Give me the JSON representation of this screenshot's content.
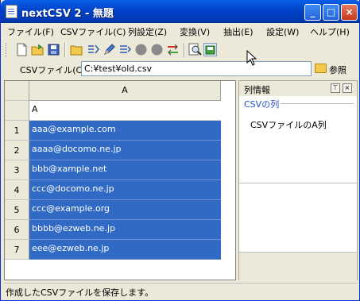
{
  "window": {
    "title": "nextCSV 2 - 無題"
  },
  "menu": [
    {
      "label": "ファイル(F)"
    },
    {
      "label": "CSVファイル(C)"
    },
    {
      "label": "列設定(Z)"
    },
    {
      "label": "変換(V)"
    },
    {
      "label": "抽出(E)"
    },
    {
      "label": "設定(W)"
    },
    {
      "label": "ヘルプ(H)"
    }
  ],
  "toolbar_icons": [
    "new-file-icon",
    "open-folder-icon",
    "save-icon",
    "folder-icon",
    "split-columns-icon",
    "pencil-icon",
    "merge-columns-icon",
    "gray-circle-icon",
    "gray-circle-icon",
    "convert-icon",
    "search-icon",
    "save-csv-icon"
  ],
  "pathbar": {
    "label": "CSVファイル(C)",
    "value": "C:¥test¥old.csv",
    "browse_label": "参照"
  },
  "grid": {
    "column_header": "A",
    "header_row_value": "A",
    "rows": [
      {
        "num": "1",
        "value": "aaa@example.com"
      },
      {
        "num": "2",
        "value": "aaaa@docomo.ne.jp"
      },
      {
        "num": "3",
        "value": "bbb@xample.net"
      },
      {
        "num": "4",
        "value": "ccc@docomo.ne.jp"
      },
      {
        "num": "5",
        "value": "ccc@example.org"
      },
      {
        "num": "6",
        "value": "bbbb@ezweb.ne.jp"
      },
      {
        "num": "7",
        "value": "eee@ezweb.ne.jp"
      }
    ]
  },
  "side_panel": {
    "title": "列情報",
    "subtitle": "CSVの列",
    "description": "CSVファイルのA列"
  },
  "status": {
    "text": "作成したCSVファイルを保存します。"
  }
}
